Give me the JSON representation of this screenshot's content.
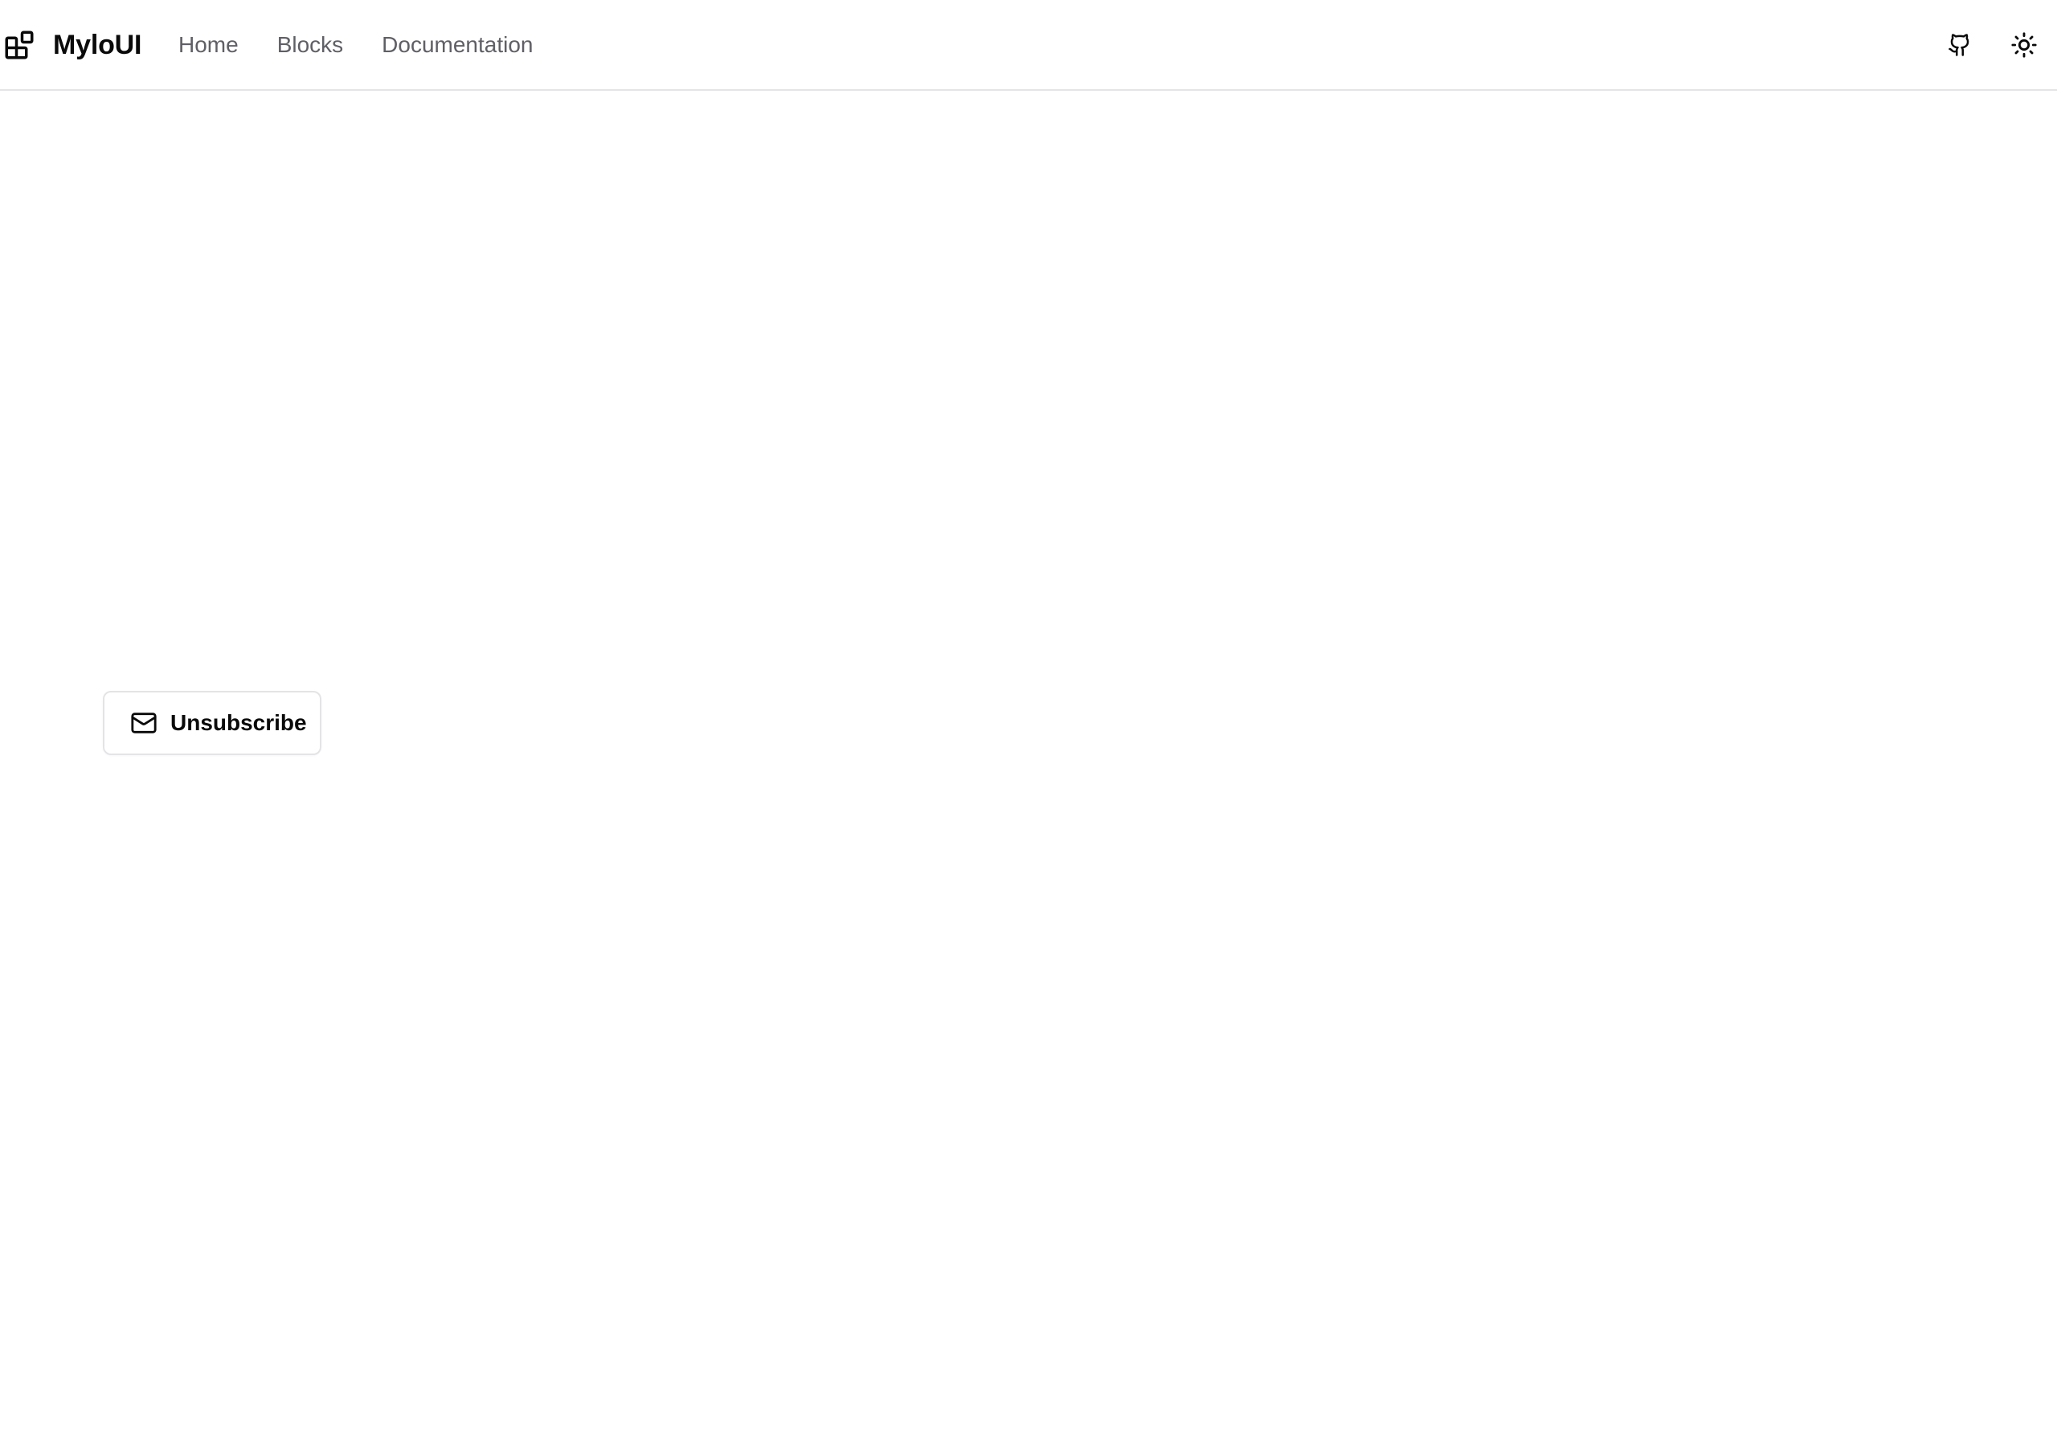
{
  "header": {
    "brand": {
      "name": "MyloUI",
      "icon": "blocks-logo-icon"
    },
    "nav": [
      {
        "label": "Home"
      },
      {
        "label": "Blocks"
      },
      {
        "label": "Documentation"
      }
    ],
    "actions": {
      "github_icon": "github-icon",
      "theme_icon": "sun-icon"
    }
  },
  "main": {
    "button": {
      "label": "Unsubscribe",
      "icon": "mail-icon"
    }
  },
  "colors": {
    "text": "#0a0a0a",
    "nav_text": "#5f5f66",
    "border": "#e4e4e7",
    "background": "#ffffff"
  }
}
